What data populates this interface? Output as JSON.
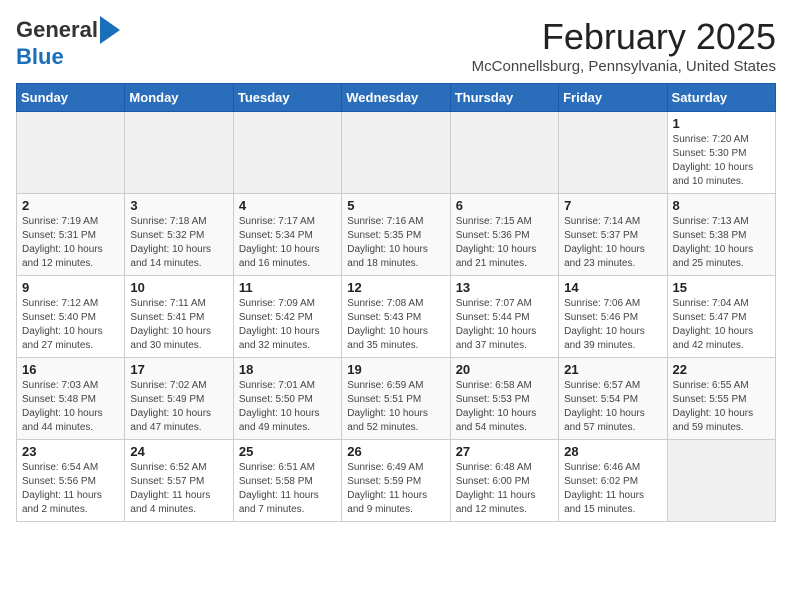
{
  "header": {
    "logo_general": "General",
    "logo_blue": "Blue",
    "month_title": "February 2025",
    "location": "McConnellsburg, Pennsylvania, United States"
  },
  "weekdays": [
    "Sunday",
    "Monday",
    "Tuesday",
    "Wednesday",
    "Thursday",
    "Friday",
    "Saturday"
  ],
  "weeks": [
    [
      {
        "day": "",
        "info": ""
      },
      {
        "day": "",
        "info": ""
      },
      {
        "day": "",
        "info": ""
      },
      {
        "day": "",
        "info": ""
      },
      {
        "day": "",
        "info": ""
      },
      {
        "day": "",
        "info": ""
      },
      {
        "day": "1",
        "info": "Sunrise: 7:20 AM\nSunset: 5:30 PM\nDaylight: 10 hours\nand 10 minutes."
      }
    ],
    [
      {
        "day": "2",
        "info": "Sunrise: 7:19 AM\nSunset: 5:31 PM\nDaylight: 10 hours\nand 12 minutes."
      },
      {
        "day": "3",
        "info": "Sunrise: 7:18 AM\nSunset: 5:32 PM\nDaylight: 10 hours\nand 14 minutes."
      },
      {
        "day": "4",
        "info": "Sunrise: 7:17 AM\nSunset: 5:34 PM\nDaylight: 10 hours\nand 16 minutes."
      },
      {
        "day": "5",
        "info": "Sunrise: 7:16 AM\nSunset: 5:35 PM\nDaylight: 10 hours\nand 18 minutes."
      },
      {
        "day": "6",
        "info": "Sunrise: 7:15 AM\nSunset: 5:36 PM\nDaylight: 10 hours\nand 21 minutes."
      },
      {
        "day": "7",
        "info": "Sunrise: 7:14 AM\nSunset: 5:37 PM\nDaylight: 10 hours\nand 23 minutes."
      },
      {
        "day": "8",
        "info": "Sunrise: 7:13 AM\nSunset: 5:38 PM\nDaylight: 10 hours\nand 25 minutes."
      }
    ],
    [
      {
        "day": "9",
        "info": "Sunrise: 7:12 AM\nSunset: 5:40 PM\nDaylight: 10 hours\nand 27 minutes."
      },
      {
        "day": "10",
        "info": "Sunrise: 7:11 AM\nSunset: 5:41 PM\nDaylight: 10 hours\nand 30 minutes."
      },
      {
        "day": "11",
        "info": "Sunrise: 7:09 AM\nSunset: 5:42 PM\nDaylight: 10 hours\nand 32 minutes."
      },
      {
        "day": "12",
        "info": "Sunrise: 7:08 AM\nSunset: 5:43 PM\nDaylight: 10 hours\nand 35 minutes."
      },
      {
        "day": "13",
        "info": "Sunrise: 7:07 AM\nSunset: 5:44 PM\nDaylight: 10 hours\nand 37 minutes."
      },
      {
        "day": "14",
        "info": "Sunrise: 7:06 AM\nSunset: 5:46 PM\nDaylight: 10 hours\nand 39 minutes."
      },
      {
        "day": "15",
        "info": "Sunrise: 7:04 AM\nSunset: 5:47 PM\nDaylight: 10 hours\nand 42 minutes."
      }
    ],
    [
      {
        "day": "16",
        "info": "Sunrise: 7:03 AM\nSunset: 5:48 PM\nDaylight: 10 hours\nand 44 minutes."
      },
      {
        "day": "17",
        "info": "Sunrise: 7:02 AM\nSunset: 5:49 PM\nDaylight: 10 hours\nand 47 minutes."
      },
      {
        "day": "18",
        "info": "Sunrise: 7:01 AM\nSunset: 5:50 PM\nDaylight: 10 hours\nand 49 minutes."
      },
      {
        "day": "19",
        "info": "Sunrise: 6:59 AM\nSunset: 5:51 PM\nDaylight: 10 hours\nand 52 minutes."
      },
      {
        "day": "20",
        "info": "Sunrise: 6:58 AM\nSunset: 5:53 PM\nDaylight: 10 hours\nand 54 minutes."
      },
      {
        "day": "21",
        "info": "Sunrise: 6:57 AM\nSunset: 5:54 PM\nDaylight: 10 hours\nand 57 minutes."
      },
      {
        "day": "22",
        "info": "Sunrise: 6:55 AM\nSunset: 5:55 PM\nDaylight: 10 hours\nand 59 minutes."
      }
    ],
    [
      {
        "day": "23",
        "info": "Sunrise: 6:54 AM\nSunset: 5:56 PM\nDaylight: 11 hours\nand 2 minutes."
      },
      {
        "day": "24",
        "info": "Sunrise: 6:52 AM\nSunset: 5:57 PM\nDaylight: 11 hours\nand 4 minutes."
      },
      {
        "day": "25",
        "info": "Sunrise: 6:51 AM\nSunset: 5:58 PM\nDaylight: 11 hours\nand 7 minutes."
      },
      {
        "day": "26",
        "info": "Sunrise: 6:49 AM\nSunset: 5:59 PM\nDaylight: 11 hours\nand 9 minutes."
      },
      {
        "day": "27",
        "info": "Sunrise: 6:48 AM\nSunset: 6:00 PM\nDaylight: 11 hours\nand 12 minutes."
      },
      {
        "day": "28",
        "info": "Sunrise: 6:46 AM\nSunset: 6:02 PM\nDaylight: 11 hours\nand 15 minutes."
      },
      {
        "day": "",
        "info": ""
      }
    ]
  ]
}
